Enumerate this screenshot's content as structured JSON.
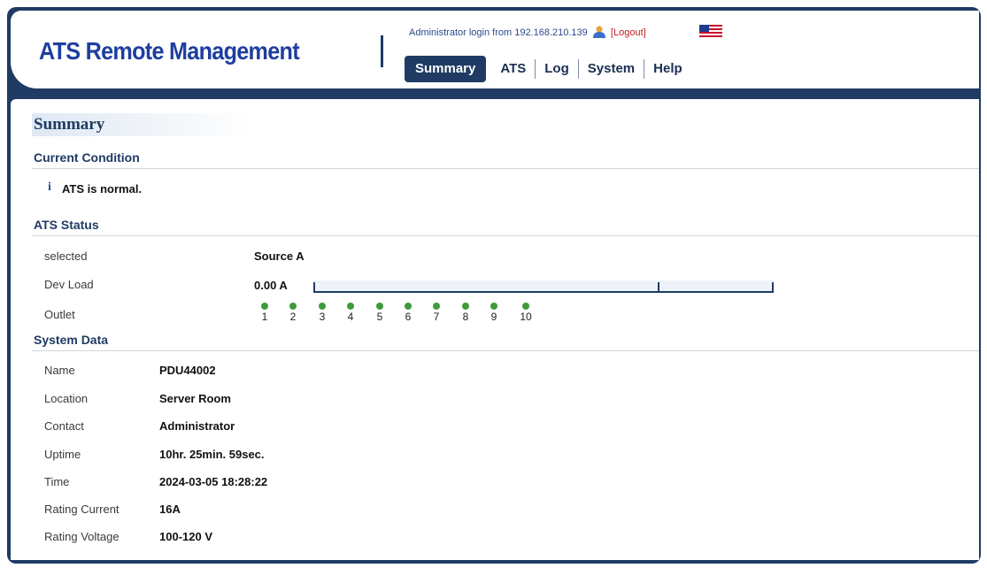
{
  "header": {
    "brand": "ATS Remote Management",
    "login_text": "Administrator login from 192.168.210.139",
    "logout_label": "[Logout]",
    "user_icon": "user-icon",
    "flag_icon": "us-flag-icon",
    "nav": [
      {
        "label": "Summary",
        "active": true
      },
      {
        "label": "ATS"
      },
      {
        "label": "Log"
      },
      {
        "label": "System"
      },
      {
        "label": "Help"
      }
    ]
  },
  "page": {
    "title": "Summary",
    "current_condition": {
      "heading": "Current Condition",
      "icon": "info-icon",
      "icon_glyph": "i",
      "message": "ATS is normal."
    },
    "ats_status": {
      "heading": "ATS Status",
      "selected_label": "selected",
      "selected_value": "Source A",
      "load_label": "Dev Load",
      "load_value": "0.00 A",
      "outlet_label": "Outlet",
      "outlets": [
        "1",
        "2",
        "3",
        "4",
        "5",
        "6",
        "7",
        "8",
        "9",
        "10"
      ],
      "outlet_status_color": "#3f9a3b"
    },
    "system_data": {
      "heading": "System Data",
      "rows": [
        {
          "label": "Name",
          "value": "PDU44002"
        },
        {
          "label": "Location",
          "value": "Server Room"
        },
        {
          "label": "Contact",
          "value": "Administrator"
        },
        {
          "label": "Uptime",
          "value": "10hr. 25min. 59sec."
        },
        {
          "label": "Time",
          "value": "2024-03-05 18:28:22"
        },
        {
          "label": "Rating Current",
          "value": "16A"
        },
        {
          "label": "Rating Voltage",
          "value": "100-120 V"
        }
      ]
    }
  },
  "colors": {
    "frame": "#1f3b63",
    "brand": "#1e3ea0",
    "logout": "#c02020"
  }
}
